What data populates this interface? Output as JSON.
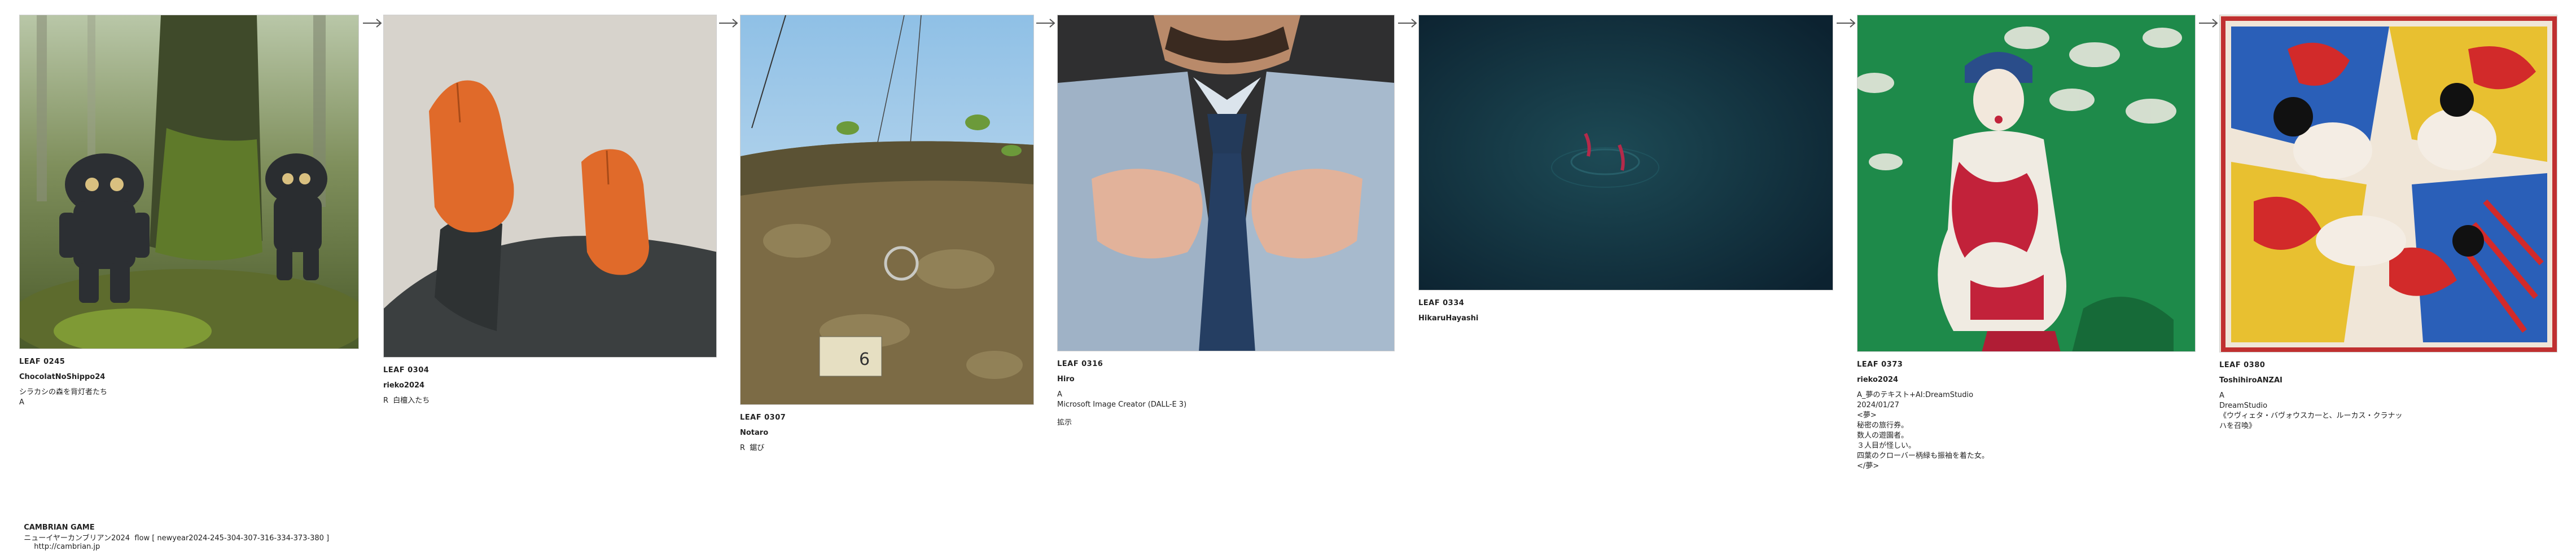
{
  "arrow_glyph": "→",
  "cards": [
    {
      "leaf": "LEAF 0245",
      "author": "ChocolatNoShippo24",
      "lines": [
        "シラカシの森を背灯者たち",
        "A"
      ]
    },
    {
      "leaf": "LEAF 0304",
      "author": "rieko2024",
      "lines": [
        "R  白檀入たち"
      ]
    },
    {
      "leaf": "LEAF 0307",
      "author": "Notaro",
      "lines": [
        "R  鋸び"
      ]
    },
    {
      "leaf": "LEAF 0316",
      "author": "Hiro",
      "lines": [
        "A",
        "Microsoft Image Creator (DALL-E 3)"
      ],
      "extra": "拡示"
    },
    {
      "leaf": "LEAF 0334",
      "author": "HikaruHayashi",
      "lines": []
    },
    {
      "leaf": "LEAF 0373",
      "author": "rieko2024",
      "lines": [
        "A_夢のテキスト+AI:DreamStudio",
        "2024/01/27",
        "<夢>",
        "秘密の旅行券。",
        "数人の遊園者。",
        "３人目が怪しい。",
        "四葉のクローバー柄緑も振袖を着た女。",
        "</夢>"
      ]
    },
    {
      "leaf": "LEAF 0380",
      "author": "ToshihiroANZAI",
      "lines": [
        "A",
        "DreamStudio",
        "《ウヴィェタ・バヴォウスカ一と、ルーカス・クラナッ",
        "ハを召喚》"
      ]
    }
  ],
  "footer": {
    "game": "CAMBRIAN GAME",
    "flow": "ニューイヤーカンブリアン2024  flow [ newyear2024-245-304-307-316-334-373-380 ]",
    "url": "http://cambrian.jp"
  },
  "icons": {
    "arrow": "right-arrow-icon"
  }
}
